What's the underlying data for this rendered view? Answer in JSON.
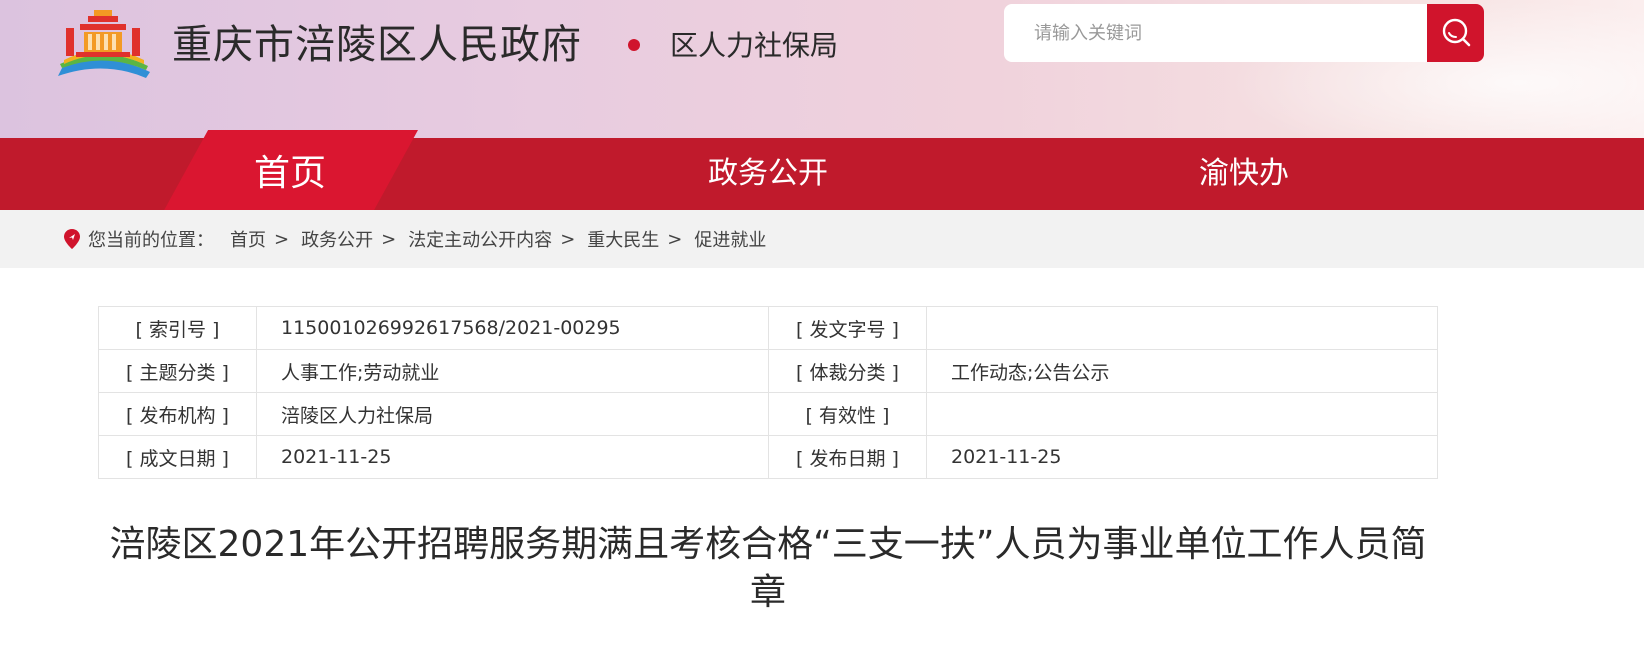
{
  "header": {
    "site_title": "重庆市涪陵区人民政府",
    "dept_title": "区人力社保局",
    "search_placeholder": "请输入关键词"
  },
  "nav": {
    "items": [
      {
        "label": "首页",
        "active": true
      },
      {
        "label": "政务公开",
        "active": false
      },
      {
        "label": "渝快办",
        "active": false
      }
    ]
  },
  "breadcrumb": {
    "label": "您当前的位置：",
    "items": [
      "首页",
      "政务公开",
      "法定主动公开内容",
      "重大民生",
      "促进就业"
    ],
    "separator": ">"
  },
  "meta": {
    "rows": [
      {
        "k1": "[ 索引号 ]",
        "v1": "11500102699261756​8/2021-00295",
        "k2": "[ 发文字号 ]",
        "v2": ""
      },
      {
        "k1": "[ 主题分类 ]",
        "v1": "人事工作;劳动就业",
        "k2": "[ 体裁分类 ]",
        "v2": "工作动态;公告公示"
      },
      {
        "k1": "[ 发布机构 ]",
        "v1": "涪陵区人力社保局",
        "k2": "[ 有效性 ]",
        "v2": ""
      },
      {
        "k1": "[ 成文日期 ]",
        "v1": "2021-11-25",
        "k2": "[ 发布日期 ]",
        "v2": "2021-11-25"
      }
    ]
  },
  "article": {
    "title": "涪陵区2021年公开招聘服务期满且考核合格“三支一扶”人员为事业单位工作人员简章"
  },
  "colors": {
    "brand_red": "#c01a2c",
    "active_red": "#da1630",
    "search_red": "#d0142c"
  }
}
